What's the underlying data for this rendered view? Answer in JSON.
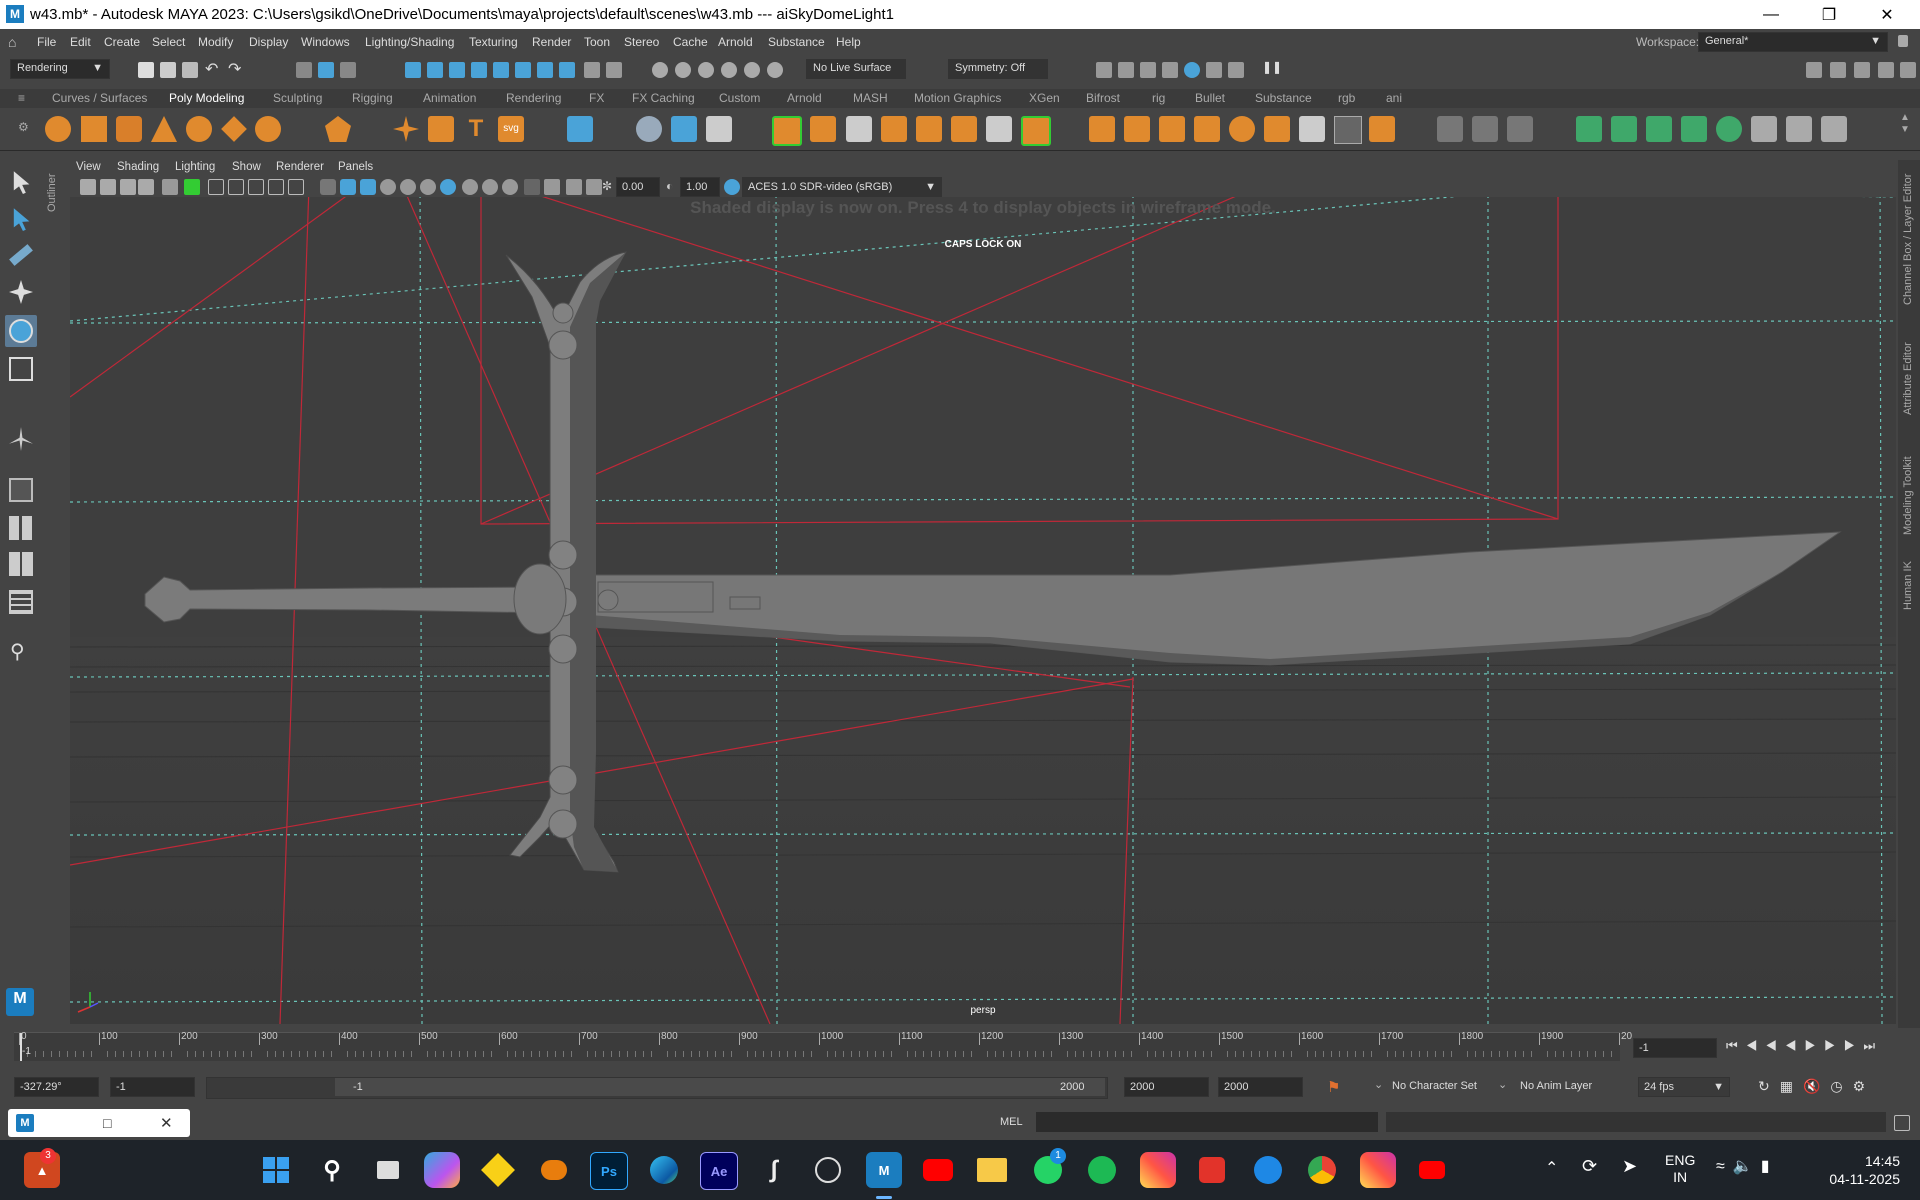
{
  "window": {
    "title": "w43.mb* - Autodesk MAYA 2023: C:\\Users\\gsikd\\OneDrive\\Documents\\maya\\projects\\default\\scenes\\w43.mb   ---   aiSkyDomeLight1"
  },
  "menus": [
    "File",
    "Edit",
    "Create",
    "Select",
    "Modify",
    "Display",
    "Windows",
    "Lighting/Shading",
    "Texturing",
    "Render",
    "Toon",
    "Stereo",
    "Cache",
    "Arnold",
    "Substance",
    "Help"
  ],
  "workspace": {
    "label": "Workspace:",
    "value": "General*"
  },
  "statusline": {
    "menuset": "Rendering",
    "live_surface": "No Live Surface",
    "symmetry": "Symmetry: Off"
  },
  "shelf_tabs": [
    "Curves / Surfaces",
    "Poly Modeling",
    "Sculpting",
    "Rigging",
    "Animation",
    "Rendering",
    "FX",
    "FX Caching",
    "Custom",
    "Arnold",
    "MASH",
    "Motion Graphics",
    "XGen",
    "Bifrost",
    "rig",
    "Bullet",
    "Substance",
    "rgb",
    "ani"
  ],
  "shelf_active": "Poly Modeling",
  "panel_menus": [
    "View",
    "Shading",
    "Lighting",
    "Show",
    "Renderer",
    "Panels"
  ],
  "panel_toolbar": {
    "exposure": "0.00",
    "gamma": "1.00",
    "colorspace": "ACES 1.0 SDR-video (sRGB)"
  },
  "viewport": {
    "message": "Shaded display is now on. Press 4 to display objects in wireframe mode.",
    "caps": "CAPS LOCK ON",
    "camera": "persp"
  },
  "side_labels": {
    "outliner": "Outliner",
    "right": [
      "Channel Box / Layer Editor",
      "Attribute Editor",
      "Modeling Toolkit",
      "Human IK"
    ]
  },
  "timeline": {
    "ticks": [
      "0",
      "100",
      "200",
      "300",
      "400",
      "500",
      "600",
      "700",
      "800",
      "900",
      "1000",
      "1100",
      "1200",
      "1300",
      "1400",
      "1500",
      "1600",
      "1700",
      "1800",
      "1900",
      "20"
    ],
    "current_marker": "-1",
    "current_frame": "-1"
  },
  "range": {
    "angle": "-327.29°",
    "start": "-1",
    "range_start": "-1",
    "range_end": "2000",
    "end1": "2000",
    "end2": "2000",
    "character_set": "No Character Set",
    "anim_layer": "No Anim Layer",
    "fps": "24 fps"
  },
  "cmd": {
    "label": "MEL"
  },
  "taskbar": {
    "lang1": "ENG",
    "lang2": "IN",
    "time": "14:45",
    "date": "04-11-2025",
    "badge_app": "3",
    "badge_wa": "1",
    "apps": [
      "Ps",
      "Ae",
      "M"
    ]
  }
}
